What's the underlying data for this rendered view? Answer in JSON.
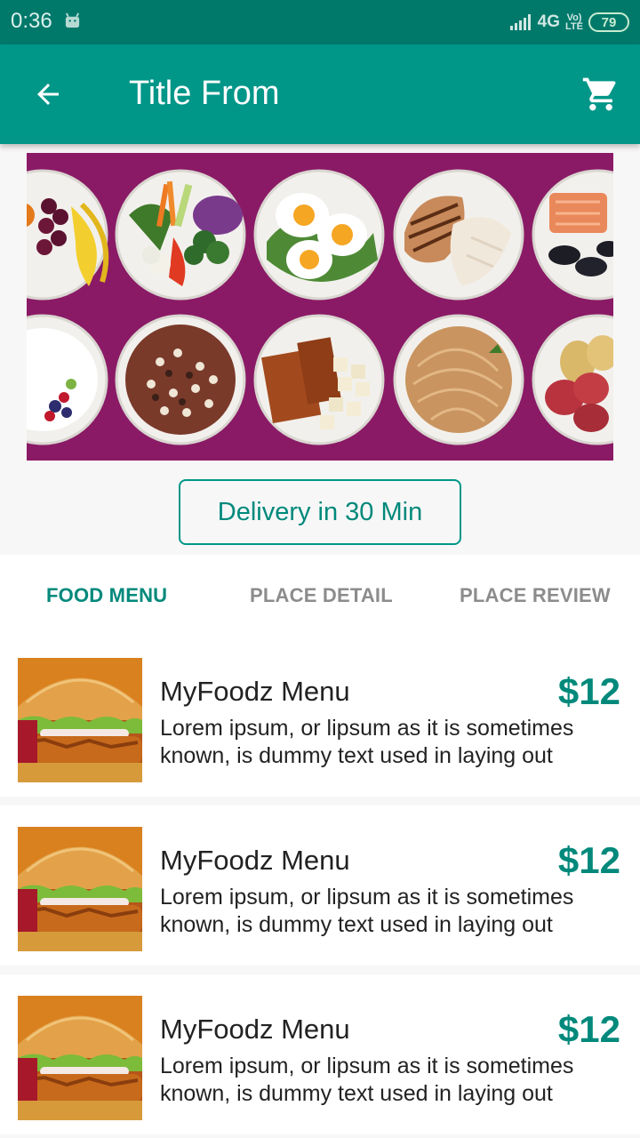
{
  "status_bar": {
    "time": "0:36",
    "network": "4G",
    "volte_top": "Vo)",
    "volte_bottom": "LTE",
    "battery": "79"
  },
  "app_bar": {
    "title": "Title From",
    "back_icon": "arrow-back-icon",
    "cart_icon": "shopping-cart-icon",
    "color": "#009688"
  },
  "delivery_button": {
    "label": "Delivery in 30 Min"
  },
  "tabs": [
    {
      "label": "FOOD MENU",
      "active": true
    },
    {
      "label": "PLACE DETAIL",
      "active": false
    },
    {
      "label": "PLACE REVIEW",
      "active": false
    }
  ],
  "menu_items": [
    {
      "name": "MyFoodz Menu",
      "price": "$12",
      "description": "Lorem ipsum, or lipsum as it is sometimes known, is dummy text used in laying out"
    },
    {
      "name": "MyFoodz Menu",
      "price": "$12",
      "description": "Lorem ipsum, or lipsum as it is sometimes known, is dummy text used in laying out"
    },
    {
      "name": "MyFoodz Menu",
      "price": "$12",
      "description": "Lorem ipsum, or lipsum as it is sometimes known, is dummy text used in laying out"
    }
  ],
  "colors": {
    "accent": "#009688",
    "status_bar": "#00796b",
    "hero_background": "#8a1a66"
  }
}
